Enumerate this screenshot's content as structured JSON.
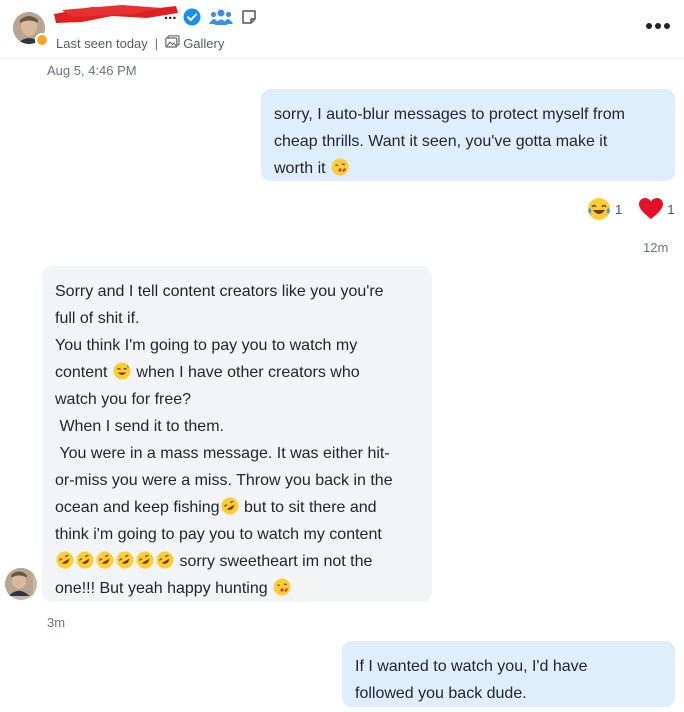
{
  "header": {
    "name_suffix": "...",
    "last_seen": "Last seen today",
    "separator": "|",
    "gallery_label": "Gallery"
  },
  "messages": [
    {
      "direction": "outgoing",
      "timestamp": "Aug 5, 4:46 PM",
      "lines": [
        "sorry, I auto-blur messages to protect myself from",
        "cheap thrills. Want it seen, you've gotta make it",
        "worth it "
      ],
      "trailing_emoji": "kiss-face",
      "reactions": [
        {
          "emoji": "laughing-tears",
          "count": "1"
        },
        {
          "emoji": "red-heart",
          "count": "1"
        }
      ]
    },
    {
      "direction": "incoming",
      "timestamp": "12m",
      "lines": [
        "Sorry and I tell content creators like you you're",
        "full of shit if.",
        "You think I'm going to pay you to watch my",
        "content ",
        " when I have other creators who",
        "watch you for free?",
        " When I send it to them.",
        " You were in a mass message. It was either hit-",
        "or-miss you were a miss. Throw you back in the",
        "ocean and keep fishing",
        " but to sit there and",
        "think i'm going to pay you to watch my content",
        " sorry sweetheart im not the",
        "one!!! But yeah happy hunting "
      ]
    },
    {
      "direction": "outgoing",
      "timestamp": "3m",
      "lines": [
        "If I wanted to watch you, I'd have",
        "followed you back dude."
      ]
    }
  ],
  "colors": {
    "outgoing_bubble": "#deeefc",
    "incoming_bubble": "#f2f4f6",
    "verified_badge": "#1c8ef2",
    "online_dot": "#f5a623",
    "redaction": "#e02020"
  }
}
